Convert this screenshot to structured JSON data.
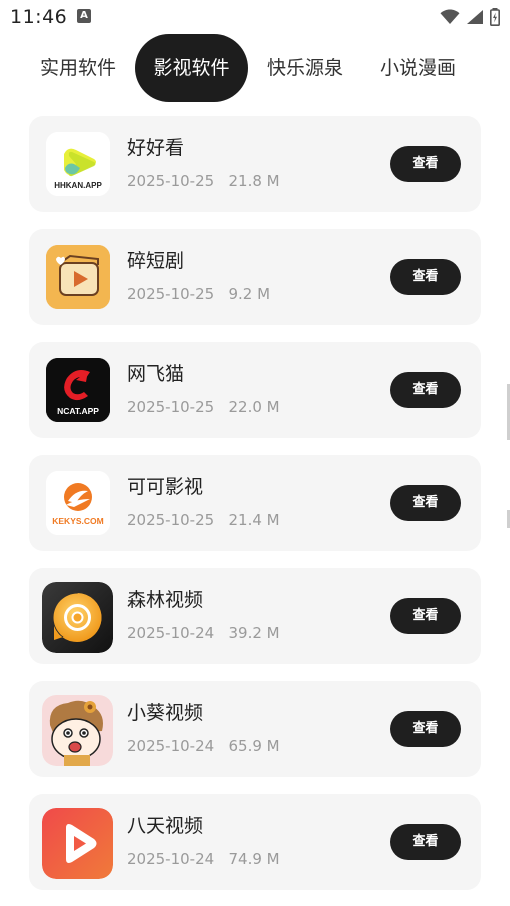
{
  "status": {
    "time": "11:46",
    "notification_icon": "a-icon"
  },
  "tabs": [
    {
      "label": "实用软件",
      "active": false
    },
    {
      "label": "影视软件",
      "active": true
    },
    {
      "label": "快乐源泉",
      "active": false
    },
    {
      "label": "小说漫画",
      "active": false
    }
  ],
  "apps": [
    {
      "name": "好好看",
      "date": "2025-10-25",
      "size": "21.8 M",
      "button": "查看",
      "icon": "hhkan-logo-icon",
      "icon_text": "HHKAN.APP"
    },
    {
      "name": "碎短剧",
      "date": "2025-10-25",
      "size": "9.2 M",
      "button": "查看",
      "icon": "clapperboard-play-icon"
    },
    {
      "name": "网飞猫",
      "date": "2025-10-25",
      "size": "22.0 M",
      "button": "查看",
      "icon": "ncat-logo-icon",
      "icon_text": "NCAT.APP"
    },
    {
      "name": "可可影视",
      "date": "2025-10-25",
      "size": "21.4 M",
      "button": "查看",
      "icon": "kekys-logo-icon",
      "icon_text": "KEKYS.COM"
    },
    {
      "name": "森林视频",
      "date": "2025-10-24",
      "size": "39.2 M",
      "button": "查看",
      "icon": "orange-lens-icon"
    },
    {
      "name": "小葵视频",
      "date": "2025-10-24",
      "size": "65.9 M",
      "button": "查看",
      "icon": "cartoon-kid-icon"
    },
    {
      "name": "八天视频",
      "date": "2025-10-24",
      "size": "74.9 M",
      "button": "查看",
      "icon": "red-play-icon"
    }
  ]
}
